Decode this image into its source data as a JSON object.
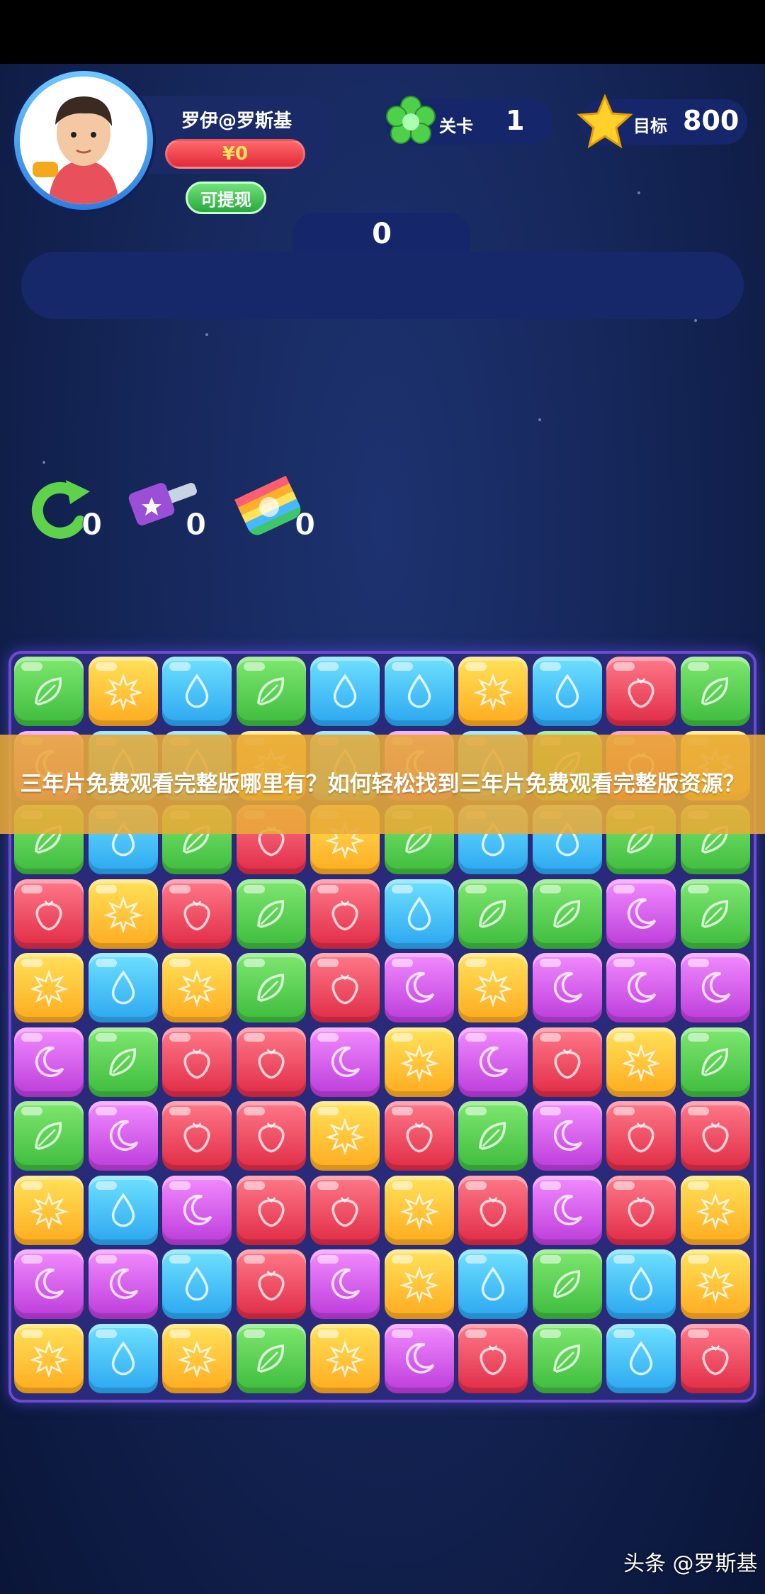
{
  "player": {
    "name": "罗伊@罗斯基",
    "balance": "¥0",
    "withdraw_label": "可提现"
  },
  "level": {
    "label": "关卡",
    "value": "1"
  },
  "goal": {
    "label": "目标",
    "value": "800"
  },
  "score": "0",
  "tools": [
    {
      "name": "refresh",
      "count": "0"
    },
    {
      "name": "hammer",
      "count": "0"
    },
    {
      "name": "rainbow",
      "count": "0"
    }
  ],
  "overlay_title": "三年片免费观看完整版哪里有？如何轻松找到三年片免费观看完整版资源？",
  "watermark": "头条 @罗斯基",
  "colors": {
    "green": "#4fd04a",
    "yellow": "#ffc23a",
    "blue": "#3ec0f5",
    "red": "#ef4458",
    "purple": "#d153ec"
  },
  "board": [
    [
      "green",
      "yellow",
      "blue",
      "green",
      "blue",
      "blue",
      "yellow",
      "blue",
      "red",
      "green"
    ],
    [
      "purple",
      "blue",
      "blue",
      "yellow",
      "blue",
      "purple",
      "blue",
      "green",
      "red",
      "yellow"
    ],
    [
      "green",
      "blue",
      "green",
      "red",
      "yellow",
      "green",
      "blue",
      "blue",
      "green",
      "green"
    ],
    [
      "red",
      "yellow",
      "red",
      "green",
      "red",
      "blue",
      "green",
      "green",
      "purple",
      "green"
    ],
    [
      "yellow",
      "blue",
      "yellow",
      "green",
      "red",
      "purple",
      "yellow",
      "purple",
      "purple",
      "purple"
    ],
    [
      "purple",
      "green",
      "red",
      "red",
      "purple",
      "yellow",
      "purple",
      "red",
      "yellow",
      "green"
    ],
    [
      "green",
      "purple",
      "red",
      "red",
      "yellow",
      "red",
      "green",
      "purple",
      "red",
      "red"
    ],
    [
      "yellow",
      "blue",
      "purple",
      "red",
      "red",
      "yellow",
      "red",
      "purple",
      "red",
      "yellow"
    ],
    [
      "purple",
      "purple",
      "blue",
      "red",
      "purple",
      "yellow",
      "blue",
      "green",
      "blue",
      "yellow"
    ],
    [
      "yellow",
      "blue",
      "yellow",
      "green",
      "yellow",
      "purple",
      "red",
      "green",
      "blue",
      "red"
    ]
  ]
}
